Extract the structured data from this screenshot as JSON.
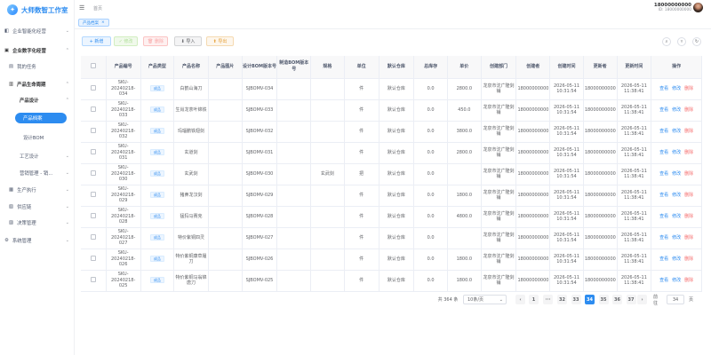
{
  "app": {
    "logo_text": "大师数智工作室"
  },
  "sidebar": {
    "items": [
      {
        "label": "企业智能化经营",
        "level": 0
      },
      {
        "label": "企业数字化经营",
        "level": 0
      },
      {
        "label": "我的任务",
        "level": 1
      },
      {
        "label": "产品生命周期",
        "level": 1
      },
      {
        "label": "产品设计",
        "level": 2
      },
      {
        "label": "产品档案",
        "level": 3
      },
      {
        "label": "设计BOM",
        "level": 3
      },
      {
        "label": "工艺设计",
        "level": 2
      },
      {
        "label": "营销管理 - 销...",
        "level": 2
      },
      {
        "label": "生产执行",
        "level": 1
      },
      {
        "label": "供应链",
        "level": 1
      },
      {
        "label": "决策管理",
        "level": 1
      },
      {
        "label": "系统管理",
        "level": 0
      }
    ]
  },
  "header": {
    "breadcrumb": "首页",
    "user_name": "18000000000",
    "user_id": "ID: 18000000000"
  },
  "tags": [
    {
      "label": "产品档案",
      "close": "×"
    }
  ],
  "toolbar": {
    "add": "+ 新增",
    "edit": "✓ 修改",
    "delete": "🗑 删除",
    "import": "⬇ 导入",
    "export": "⬆ 导出"
  },
  "table": {
    "columns": [
      "",
      "产品编号",
      "产品类型",
      "产品名称",
      "产品图片",
      "设计BOM版本号",
      "制造BOM版本号",
      "规格",
      "单位",
      "默认仓库",
      "总库存",
      "单价",
      "创建部门",
      "创建者",
      "创建时间",
      "更新者",
      "更新时间",
      "操作"
    ],
    "rows": [
      {
        "code": "SKU-20240218-034",
        "type": "成品",
        "name": "白鹤山海刀",
        "image": "",
        "dbom": "SJBOMV-034",
        "mbom": "",
        "spec": "",
        "unit": "件",
        "warehouse": "默认仓库",
        "stock": "0.0",
        "price": "2800.0",
        "dept": "龙泉市沈广隆剑铺",
        "creator": "18000000000",
        "ctime": "2026-05-11 10:31:54",
        "updater": "18000000000",
        "utime": "2026-05-11 11:38:41"
      },
      {
        "code": "SKU-20240218-033",
        "type": "成品",
        "name": "生肖龙茶叶锦铁",
        "image": "",
        "dbom": "SJBOMV-033",
        "mbom": "",
        "spec": "",
        "unit": "件",
        "warehouse": "默认仓库",
        "stock": "0.0",
        "price": "450.0",
        "dept": "龙泉市沈广隆剑铺",
        "creator": "18000000000",
        "ctime": "2026-05-11 10:31:54",
        "updater": "18000000000",
        "utime": "2026-05-11 11:38:41"
      },
      {
        "code": "SKU-20240218-032",
        "type": "成品",
        "name": "玛瑙鹏铁翅剑",
        "image": "",
        "dbom": "SJBOMV-032",
        "mbom": "",
        "spec": "",
        "unit": "件",
        "warehouse": "默认仓库",
        "stock": "0.0",
        "price": "3800.0",
        "dept": "龙泉市沈广隆剑铺",
        "creator": "18000000000",
        "ctime": "2026-05-11 10:31:54",
        "updater": "18000000000",
        "utime": "2026-05-11 11:38:41"
      },
      {
        "code": "SKU-20240218-031",
        "type": "成品",
        "name": "玄道剑",
        "image": "",
        "dbom": "SJBOMV-031",
        "mbom": "",
        "spec": "",
        "unit": "件",
        "warehouse": "默认仓库",
        "stock": "0.0",
        "price": "2800.0",
        "dept": "龙泉市沈广隆剑铺",
        "creator": "18000000000",
        "ctime": "2026-05-11 10:31:54",
        "updater": "18000000000",
        "utime": "2026-05-11 11:38:41"
      },
      {
        "code": "SKU-20240218-030",
        "type": "成品",
        "name": "玄武剑",
        "image": "",
        "dbom": "SJBOMV-030",
        "mbom": "",
        "spec": "玄武剑",
        "unit": "把",
        "warehouse": "默认仓库",
        "stock": "0.0",
        "price": "",
        "dept": "龙泉市沈广隆剑铺",
        "creator": "18000000000",
        "ctime": "2026-05-11 10:31:54",
        "updater": "18000000000",
        "utime": "2026-05-11 11:38:41"
      },
      {
        "code": "SKU-20240218-029",
        "type": "成品",
        "name": "猪鼻龙汉剑",
        "image": "",
        "dbom": "SJBOMV-029",
        "mbom": "",
        "spec": "",
        "unit": "件",
        "warehouse": "默认仓库",
        "stock": "0.0",
        "price": "1800.0",
        "dept": "龙泉市沈广隆剑铺",
        "creator": "18000000000",
        "ctime": "2026-05-11 10:31:54",
        "updater": "18000000000",
        "utime": "2026-05-11 11:38:41"
      },
      {
        "code": "SKU-20240218-028",
        "type": "成品",
        "name": "猛犸马赛克",
        "image": "",
        "dbom": "SJBOMV-028",
        "mbom": "",
        "spec": "",
        "unit": "件",
        "warehouse": "默认仓库",
        "stock": "0.0",
        "price": "4800.0",
        "dept": "龙泉市沈广隆剑铺",
        "creator": "18000000000",
        "ctime": "2026-05-11 10:31:54",
        "updater": "18000000000",
        "utime": "2026-05-11 11:38:41"
      },
      {
        "code": "SKU-20240218-027",
        "type": "成品",
        "name": "特价紫铜四灵",
        "image": "",
        "dbom": "SJBOMV-027",
        "mbom": "",
        "spec": "",
        "unit": "件",
        "warehouse": "默认仓库",
        "stock": "0.0",
        "price": "",
        "dept": "龙泉市沈广隆剑铺",
        "creator": "18000000000",
        "ctime": "2026-05-11 10:31:54",
        "updater": "18000000000",
        "utime": "2026-05-11 11:38:41"
      },
      {
        "code": "SKU-20240218-026",
        "type": "成品",
        "name": "特价紫铜康草履刀",
        "image": "",
        "dbom": "SJBOMV-026",
        "mbom": "",
        "spec": "",
        "unit": "件",
        "warehouse": "默认仓库",
        "stock": "0.0",
        "price": "1800.0",
        "dept": "龙泉市沈广隆剑铺",
        "creator": "18000000000",
        "ctime": "2026-05-11 10:31:54",
        "updater": "18000000000",
        "utime": "2026-05-11 11:38:41"
      },
      {
        "code": "SKU-20240218-025",
        "type": "成品",
        "name": "特价紫铜马翁锦唐刀",
        "image": "",
        "dbom": "SJBOMV-025",
        "mbom": "",
        "spec": "",
        "unit": "件",
        "warehouse": "默认仓库",
        "stock": "0.0",
        "price": "1800.0",
        "dept": "龙泉市沈广隆剑铺",
        "creator": "18000000000",
        "ctime": "2026-05-11 10:31:54",
        "updater": "18000000000",
        "utime": "2026-05-11 11:38:41"
      }
    ],
    "ops": {
      "view": "查看",
      "edit": "修改",
      "delete": "删除"
    }
  },
  "pager": {
    "total": "共 364 条",
    "size": "10条/页",
    "pages": [
      "1",
      "···",
      "32",
      "33",
      "34",
      "35",
      "36",
      "37"
    ],
    "current": "34",
    "goto": "前往",
    "goto_value": "34",
    "page_unit": "页",
    "prev": "‹",
    "next": "›"
  },
  "colors": {
    "primary": "#2d8cf0",
    "danger": "#f56c6c"
  }
}
